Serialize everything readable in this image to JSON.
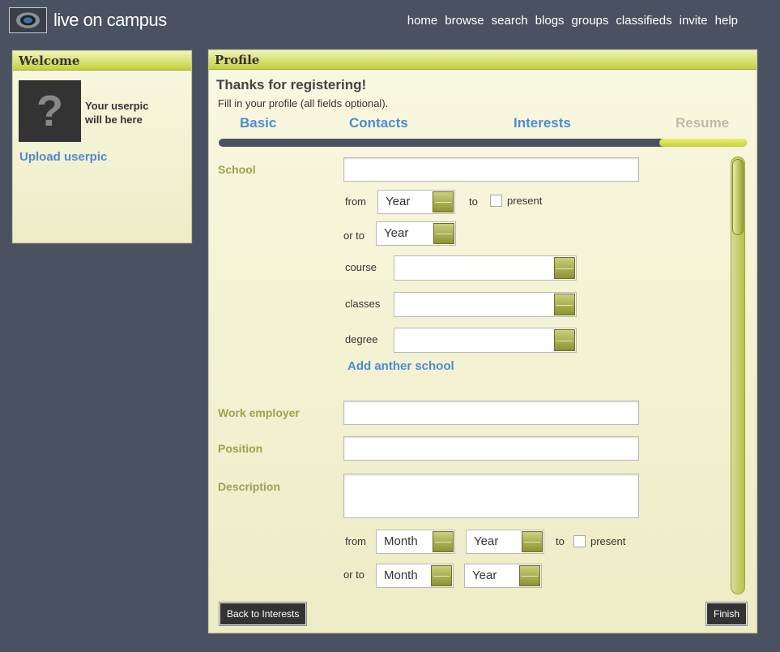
{
  "app": {
    "brand": "live on campus",
    "nav": [
      "home",
      "browse",
      "search",
      "blogs",
      "groups",
      "classifieds",
      "invite",
      "help"
    ]
  },
  "welcome": {
    "title": "Welcome",
    "userpic_placeholder": "?",
    "userpic_line1": "Your userpic",
    "userpic_line2": "will be here",
    "upload_link": "Upload userpic"
  },
  "profile": {
    "title": "Profile",
    "thanks": "Thanks for registering!",
    "subtitle": "Fill in your profile (all fields optional).",
    "steps": [
      "Basic",
      "Contacts",
      "Interests",
      "Resume"
    ],
    "active_step": "Resume",
    "progress_fraction": 0.165,
    "school": {
      "label": "School",
      "value": "",
      "from_label": "from",
      "from_year": "Year",
      "to_label": "to",
      "present_label": "present",
      "present_checked": false,
      "or_to_label": "or to",
      "or_to_year": "Year",
      "course_label": "course",
      "course_value": "",
      "classes_label": "classes",
      "classes_value": "",
      "degree_label": "degree",
      "degree_value": "",
      "add_link": "Add anther school"
    },
    "work": {
      "employer_label": "Work employer",
      "employer_value": "",
      "position_label": "Position",
      "position_value": "",
      "description_label": "Description",
      "description_value": "",
      "from_label": "from",
      "from_month": "Month",
      "from_year": "Year",
      "to_label": "to",
      "present_label": "present",
      "present_checked": false,
      "or_to_label": "or to",
      "or_to_month": "Month",
      "or_to_year": "Year"
    },
    "back_button": "Back to Interests",
    "finish_button": "Finish"
  },
  "colors": {
    "background": "#4a5160",
    "accent_link": "#4f8bd1",
    "label_olive": "#9ea14e",
    "progress_fill": "#c6d23a"
  }
}
